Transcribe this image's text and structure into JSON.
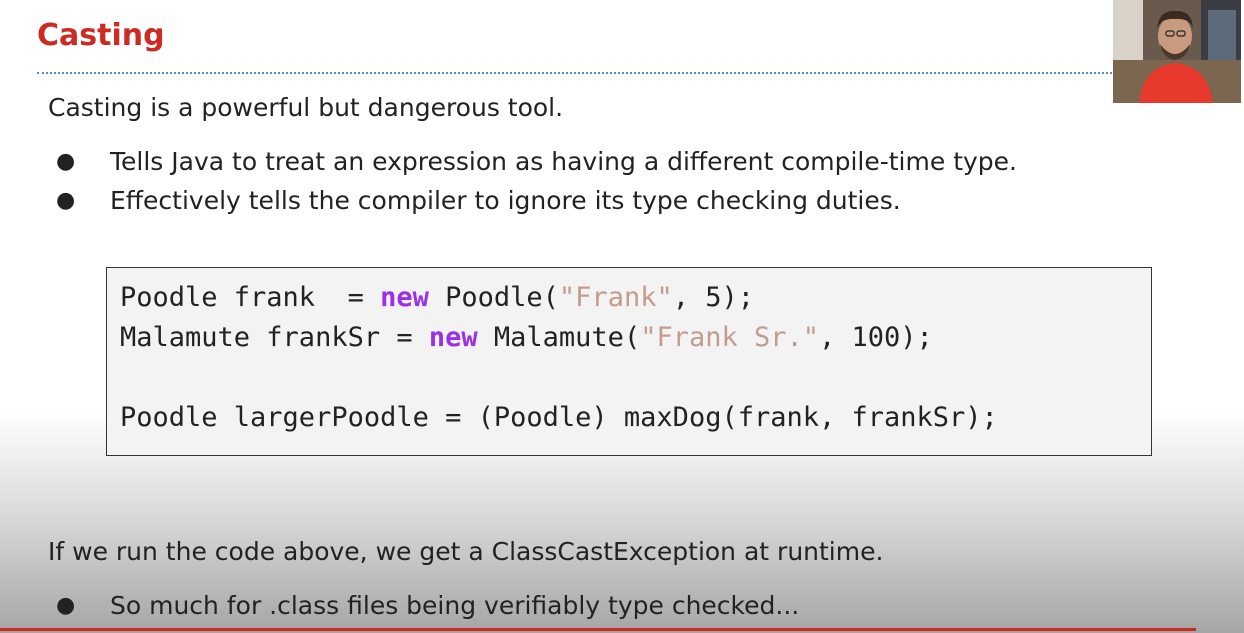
{
  "slide": {
    "title": "Casting",
    "intro": "Casting is a powerful but dangerous tool.",
    "bullets": [
      "Tells Java to treat an expression as having a different compile-time type.",
      "Effectively tells the compiler to ignore its type checking duties."
    ],
    "code": {
      "line1": {
        "pre": "Poodle frank  = ",
        "kw": "new",
        "mid": " Poodle(",
        "str": "\"Frank\"",
        "post": ", 5);"
      },
      "line2": {
        "pre": "Malamute frankSr = ",
        "kw": "new",
        "mid": " Malamute(",
        "str": "\"Frank Sr.\"",
        "post": ", 100);"
      },
      "line3": "Poodle largerPoodle = (Poodle) maxDog(frank, frankSr);"
    },
    "bottom_text": "If we run the code above, we get a ClassCastException at runtime.",
    "bottom_bullets": [
      "So much for .class files being verifiably type checked..."
    ],
    "bullet_glyph": "●"
  },
  "colors": {
    "title": "#cc2a22",
    "keyword": "#9b31e6",
    "string": "#c29d8e",
    "rule_dotted": "#4f8fc5",
    "footer_rule": "#cc2a22"
  },
  "webcam": {
    "icon": "presenter-video-thumbnail"
  }
}
